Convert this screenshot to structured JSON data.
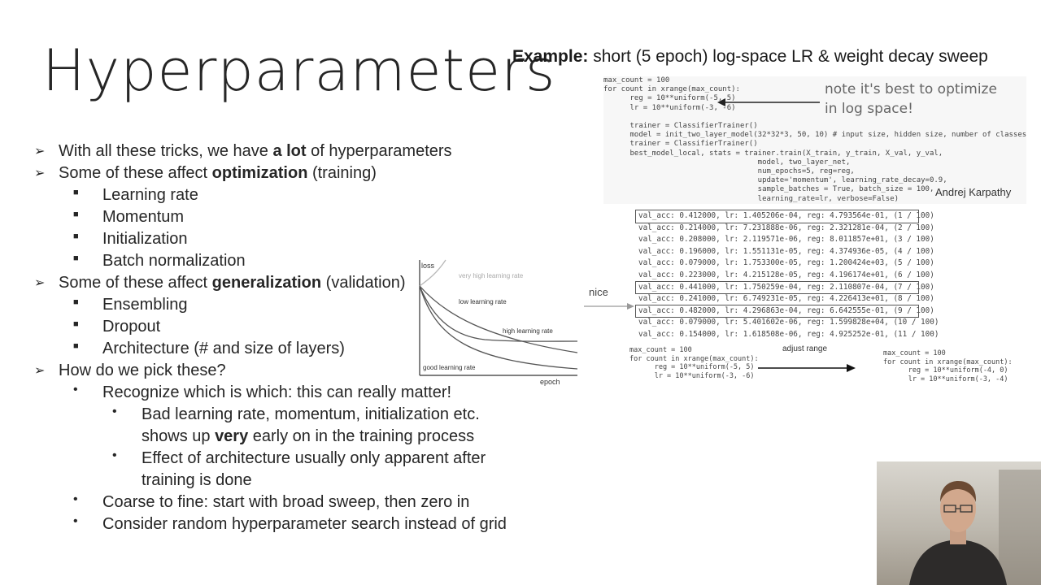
{
  "slide": {
    "title": "Hyperparameters",
    "example_bold": "Example:",
    "example_rest": " short (5 epoch) log-space LR & weight decay sweep"
  },
  "bullets": {
    "l1": {
      "pre": "With all these tricks, we have ",
      "bold": "a lot",
      "post": " of hyperparameters"
    },
    "l2": {
      "pre": "Some of these affect ",
      "bold": "optimization",
      "post": " (training)"
    },
    "opt_items": [
      "Learning rate",
      "Momentum",
      "Initialization",
      "Batch normalization"
    ],
    "l3": {
      "pre": "Some of these affect ",
      "bold": "generalization",
      "post": " (validation)"
    },
    "gen_items": [
      "Ensembling",
      "Dropout",
      "Architecture (# and size of layers)"
    ],
    "l4": "How do we pick these?",
    "pick_1": "Recognize which is which: this can really matter!",
    "pick_1a_l1": "Bad learning rate, momentum, initialization etc.",
    "pick_1a_l2": {
      "pre": "shows up ",
      "bold": "very",
      "post": " early on in the training process"
    },
    "pick_1b_l1": "Effect of architecture usually only apparent after",
    "pick_1b_l2": "training is done",
    "pick_2": "Coarse to fine: start with broad sweep, then zero in",
    "pick_3": "Consider random hyperparameter search instead of grid"
  },
  "lr_plot": {
    "ylabel": "loss",
    "xlabel": "epoch",
    "curves": {
      "very_high": "very high learning rate",
      "low": "low learning rate",
      "high": "high learning rate",
      "good": "good learning rate"
    }
  },
  "code_top": [
    "max_count = 100",
    "for count in xrange(max_count):",
    "      reg = 10**uniform(-5, 5)",
    "      lr = 10**uniform(-3, -6)",
    "",
    "      trainer = ClassifierTrainer()",
    "      model = init_two_layer_model(32*32*3, 50, 10) # input size, hidden size, number of classes",
    "      trainer = ClassifierTrainer()",
    "      best_model_local, stats = trainer.train(X_train, y_train, X_val, y_val,",
    "                                   model, two_layer_net,",
    "                                   num_epochs=5, reg=reg,",
    "                                   update='momentum', learning_rate_decay=0.9,",
    "                                   sample_batches = True, batch_size = 100,",
    "                                   learning_rate=lr, verbose=False)"
  ],
  "note": "note it's best to optimize in log space!",
  "attribution": "Andrej Karpathy",
  "results": [
    {
      "text": "val_acc: 0.412000, lr: 1.405206e-04, reg: 4.793564e-01, (1 / 100)",
      "boxed": true
    },
    {
      "text": "val_acc: 0.214000, lr: 7.231888e-06, reg: 2.321281e-04, (2 / 100)",
      "boxed": false
    },
    {
      "text": "val_acc: 0.208000, lr: 2.119571e-06, reg: 8.011857e+01, (3 / 100)",
      "boxed": false
    },
    {
      "text": "val_acc: 0.196000, lr: 1.551131e-05, reg: 4.374936e-05, (4 / 100)",
      "boxed": false
    },
    {
      "text": "val_acc: 0.079000, lr: 1.753300e-05, reg: 1.200424e+03, (5 / 100)",
      "boxed": false
    },
    {
      "text": "val_acc: 0.223000, lr: 4.215128e-05, reg: 4.196174e+01, (6 / 100)",
      "boxed": false
    },
    {
      "text": "val_acc: 0.441000, lr: 1.750259e-04, reg: 2.110807e-04, (7 / 100)",
      "boxed": true
    },
    {
      "text": "val_acc: 0.241000, lr: 6.749231e-05, reg: 4.226413e+01, (8 / 100)",
      "boxed": false
    },
    {
      "text": "val_acc: 0.482000, lr: 4.296863e-04, reg: 6.642555e-01, (9 / 100)",
      "boxed": true
    },
    {
      "text": "val_acc: 0.079000, lr: 5.401602e-06, reg: 1.599828e+04, (10 / 100)",
      "boxed": false
    },
    {
      "text": "val_acc: 0.154000, lr: 1.618508e-06, reg: 4.925252e-01, (11 / 100)",
      "boxed": false
    }
  ],
  "nice_label": "nice",
  "code_before": [
    "max_count = 100",
    "for count in xrange(max_count):",
    "      reg = 10**uniform(-5, 5)",
    "      lr = 10**uniform(-3, -6)"
  ],
  "adjust_label": "adjust range",
  "code_after": [
    "max_count = 100",
    "for count in xrange(max_count):",
    "      reg = 10**uniform(-4, 0)",
    "      lr = 10**uniform(-3, -4)"
  ]
}
